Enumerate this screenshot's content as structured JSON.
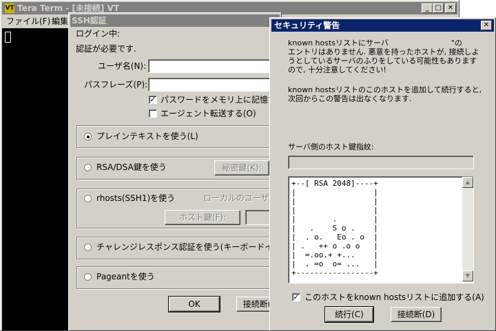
{
  "teraterm": {
    "title": "Tera Term - [未接続] VT",
    "menu": [
      "ファイル(F)",
      "編集"
    ]
  },
  "ssh_auth": {
    "title": "SSH認証",
    "logging_in": "ログイン中:",
    "auth_required": "認証が必要です.",
    "username_label": "ユーザ名(N):",
    "username_value": "",
    "passphrase_label": "パスフレーズ(P):",
    "passphrase_value": "",
    "remember_password": "パスワードをメモリ上に記憶する",
    "remember_password_checked": true,
    "agent_forward": "エージェント転送する(O)",
    "agent_forward_checked": false,
    "plaintext": "プレインテキストを使う(L)",
    "rsa_dsa": "RSA/DSA鍵を使う",
    "private_key_button": "秘密鍵(K):",
    "rhosts": "rhosts(SSH1)を使う",
    "local_user": "ローカルのユーザ名",
    "host_key_button": "ホスト鍵(F):",
    "challenge": "チャレンジレスポンス認証を使う(キーボードインタラクティブ)",
    "pageant": "Pageantを使う",
    "ok_button": "OK",
    "disconnect_button": "接続断(D)",
    "selected_method": "plaintext"
  },
  "security": {
    "title": "セキュリティ警告",
    "message1": "known hostsリストにサーバ                          \"の\nエントリはありません. 悪意を持ったホストが, 接続しよ\nうとしているサーバのふりをしている可能性もあります\nので, 十分注意してください!",
    "message2": "known hostsリストのこのホストを追加して続行すると,\n次回からこの警告は出なくなります.",
    "fingerprint_label": "サーバ側のホスト鍵指紋:",
    "fingerprint_value": "",
    "randomart": "+--[ RSA 2048]----+\n|                 |\n|                 |\n|                 |\n|        .        |\n|   .    S o .    |\n|  . o.   Eo . o  |\n| .   ++ o .o o   |\n|  =.oo.+ +...    |\n|  . =o  o= ...   |\n+-----------------+",
    "add_to_known_hosts": "このホストをknown hostsリストに追加する(A)",
    "add_checked": true,
    "continue_button": "続行(C)",
    "disconnect_button": "接続断(D)"
  }
}
